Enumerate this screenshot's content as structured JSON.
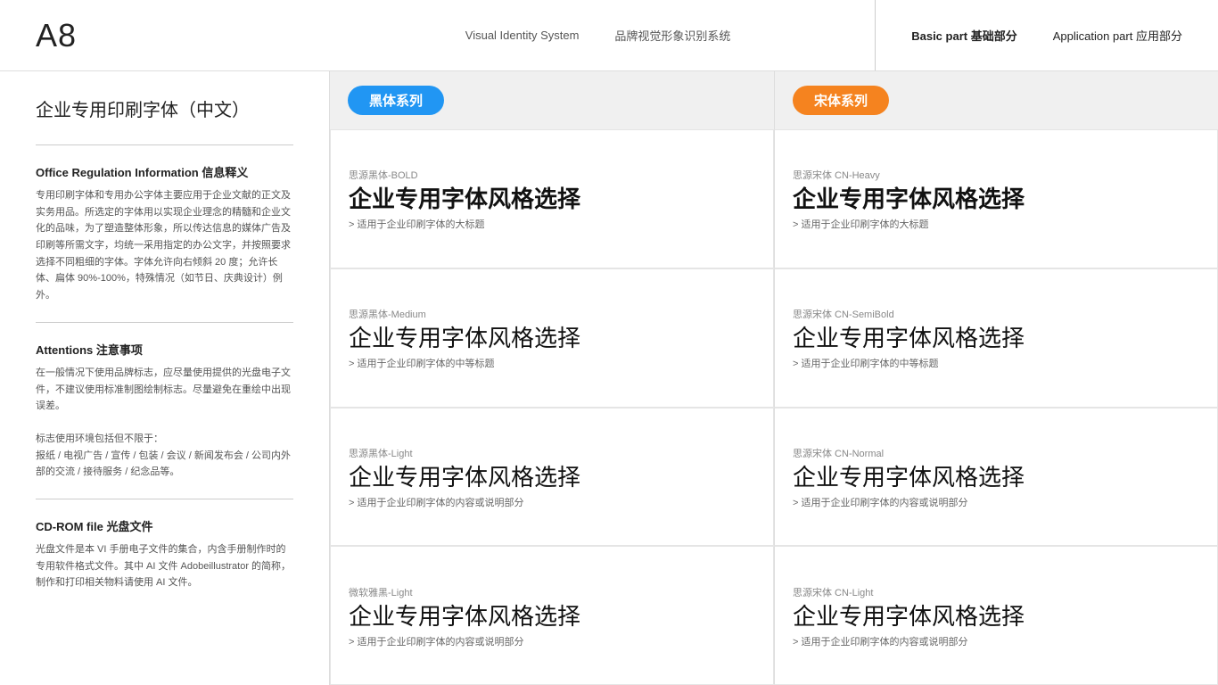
{
  "header": {
    "page_number": "A8",
    "title_en": "Visual Identity System",
    "title_cn": "品牌视觉形象识别系统",
    "nav_basic_en": "Basic part",
    "nav_basic_cn": "基础部分",
    "nav_app_en": "Application part",
    "nav_app_cn": "应用部分"
  },
  "sidebar": {
    "section_title": "企业专用印刷字体（中文）",
    "divider1": true,
    "block1": {
      "title": "Office Regulation Information 信息释义",
      "text": "专用印刷字体和专用办公字体主要应用于企业文献的正文及实务用品。所选定的字体用以实现企业理念的精髓和企业文化的品味，为了塑造整体形象，所以传达信息的媒体广告及印刷等所需文字，均统一采用指定的办公文字，并按照要求选择不同粗细的字体。字体允许向右倾斜 20 度；允许长体、扁体 90%-100%，特殊情况（如节日、庆典设计）例外。"
    },
    "divider2": true,
    "block2": {
      "title": "Attentions 注意事项",
      "text1": "在一般情况下使用品牌标志，应尽量使用提供的光盘电子文件，不建议使用标准制图绘制标志。尽量避免在重绘中出现误差。",
      "text2": "标志使用环境包括但不限于：",
      "text3": "报纸 / 电视广告 / 宣传 / 包装 / 会议 / 新闻发布会 / 公司内外部的交流 / 接待服务 / 纪念品等。"
    },
    "divider3": true,
    "block3": {
      "title": "CD-ROM file 光盘文件",
      "text": "光盘文件是本 VI 手册电子文件的集合，内含手册制作时的专用软件格式文件。其中 AI 文件 Adobeillustrator 的简称，制作和打印相关物料请使用 AI 文件。"
    }
  },
  "content": {
    "left_badge": "黑体系列",
    "right_badge": "宋体系列",
    "rows": [
      {
        "left": {
          "font_name": "思源黑体-BOLD",
          "sample": "企业专用字体风格选择",
          "weight": "bold",
          "desc": "> 适用于企业印刷字体的大标题"
        },
        "right": {
          "font_name": "思源宋体 CN-Heavy",
          "sample": "企业专用字体风格选择",
          "weight": "bold",
          "desc": "> 适用于企业印刷字体的大标题"
        }
      },
      {
        "left": {
          "font_name": "思源黑体-Medium",
          "sample": "企业专用字体风格选择",
          "weight": "medium",
          "desc": "> 适用于企业印刷字体的中等标题"
        },
        "right": {
          "font_name": "思源宋体 CN-SemiBold",
          "sample": "企业专用字体风格选择",
          "weight": "medium",
          "desc": "> 适用于企业印刷字体的中等标题"
        }
      },
      {
        "left": {
          "font_name": "思源黑体-Light",
          "sample": "企业专用字体风格选择",
          "weight": "light",
          "desc": "> 适用于企业印刷字体的内容或说明部分"
        },
        "right": {
          "font_name": "思源宋体 CN-Normal",
          "sample": "企业专用字体风格选择",
          "weight": "light",
          "desc": "> 适用于企业印刷字体的内容或说明部分"
        }
      },
      {
        "left": {
          "font_name": "微软雅黑-Light",
          "sample": "企业专用字体风格选择",
          "weight": "light",
          "desc": "> 适用于企业印刷字体的内容或说明部分"
        },
        "right": {
          "font_name": "思源宋体 CN-Light",
          "sample": "企业专用字体风格选择",
          "weight": "light",
          "desc": "> 适用于企业印刷字体的内容或说明部分"
        }
      }
    ]
  }
}
